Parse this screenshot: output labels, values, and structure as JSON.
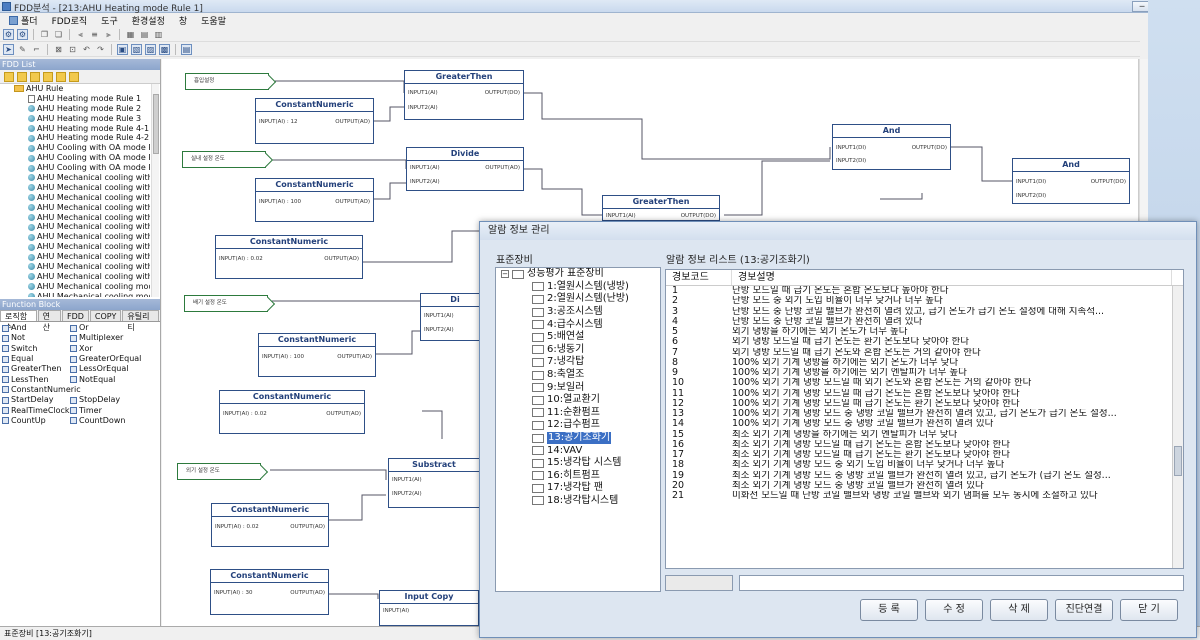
{
  "window": {
    "title": "FDD분석 - [213:AHU Heating mode Rule 1]",
    "controls": [
      "─",
      "□",
      "✕"
    ]
  },
  "menu": [
    "폴더",
    "FDD로직",
    "도구",
    "환경설정",
    "창",
    "도움말"
  ],
  "left_panel": {
    "fdd_list_title": "FDD List",
    "tree": [
      {
        "label": "AHU Rule",
        "level": 0,
        "type": "folder"
      },
      {
        "label": "AHU Heating mode Rule 1",
        "level": 1,
        "type": "doc"
      },
      {
        "label": "AHU Heating mode Rule 2",
        "level": 1,
        "type": "gear"
      },
      {
        "label": "AHU Heating mode Rule 3",
        "level": 1,
        "type": "gear"
      },
      {
        "label": "AHU Heating mode Rule 4-1",
        "level": 1,
        "type": "gear"
      },
      {
        "label": "AHU Heating mode Rule 4-2",
        "level": 1,
        "type": "gear"
      },
      {
        "label": "AHU Cooling with OA mode Rule",
        "level": 1,
        "type": "gear"
      },
      {
        "label": "AHU Cooling with OA mode Rule",
        "level": 1,
        "type": "gear"
      },
      {
        "label": "AHU Cooling with OA mode Rule",
        "level": 1,
        "type": "gear"
      },
      {
        "label": "AHU Mechanical cooling with",
        "level": 1,
        "type": "gear"
      },
      {
        "label": "AHU Mechanical cooling with",
        "level": 1,
        "type": "gear"
      },
      {
        "label": "AHU Mechanical cooling with",
        "level": 1,
        "type": "gear"
      },
      {
        "label": "AHU Mechanical cooling with",
        "level": 1,
        "type": "gear"
      },
      {
        "label": "AHU Mechanical cooling with",
        "level": 1,
        "type": "gear"
      },
      {
        "label": "AHU Mechanical cooling with",
        "level": 1,
        "type": "gear"
      },
      {
        "label": "AHU Mechanical cooling with",
        "level": 1,
        "type": "gear"
      },
      {
        "label": "AHU Mechanical cooling with",
        "level": 1,
        "type": "gear"
      },
      {
        "label": "AHU Mechanical cooling with",
        "level": 1,
        "type": "gear"
      },
      {
        "label": "AHU Mechanical cooling with",
        "level": 1,
        "type": "gear"
      },
      {
        "label": "AHU Mechanical cooling with",
        "level": 1,
        "type": "gear"
      },
      {
        "label": "AHU Mechanical cooling mod",
        "level": 1,
        "type": "gear"
      },
      {
        "label": "AHU Mechanical cooling mod",
        "level": 1,
        "type": "gear"
      }
    ],
    "function_block_title": "Function Block",
    "tabs": [
      "로직함수",
      "연산",
      "FDD",
      "COPY",
      "유틸리티"
    ],
    "functions": [
      [
        "And",
        "Or"
      ],
      [
        "Not",
        "Multiplexer"
      ],
      [
        "Switch",
        "Xor"
      ],
      [
        "Equal",
        "GreaterOrEqual"
      ],
      [
        "GreaterThen",
        "LessOrEqual"
      ],
      [
        "LessThen",
        "NotEqual"
      ],
      [
        "ConstantNumeric",
        ""
      ],
      [
        "StartDelay",
        "StopDelay"
      ],
      [
        "RealTimeClock",
        "Timer"
      ],
      [
        "CountUp",
        "CountDown"
      ]
    ]
  },
  "canvas": {
    "labels": [
      "흡입설정",
      "실내 설정 온도",
      "배기 설정 온도",
      "외기 설정 온도"
    ],
    "blocks": {
      "greater1": {
        "title": "GreaterThen",
        "in1": "INPUT1(AI)",
        "in2": "INPUT2(AI)",
        "out": "OUTPUT(DO)"
      },
      "const1": {
        "title": "ConstantNumeric",
        "in": "INPUT(AI) : 12",
        "out": "OUTPUT(AO)"
      },
      "divide": {
        "title": "Divide",
        "in1": "INPUT1(AI)",
        "in2": "INPUT2(AI)",
        "out": "OUTPUT(AO)"
      },
      "const2": {
        "title": "ConstantNumeric",
        "in": "INPUT(AI) : 100",
        "out": "OUTPUT(AO)"
      },
      "greater2": {
        "title": "GreaterThen",
        "in1": "INPUT1(AI)",
        "out": "OUTPUT(DO)"
      },
      "and1": {
        "title": "And",
        "in1": "INPUT1(DI)",
        "in2": "INPUT2(DI)",
        "out": "OUTPUT(DO)"
      },
      "and2": {
        "title": "And",
        "in1": "INPUT1(DI)",
        "in2": "INPUT2(DI)",
        "out": "OUTPUT(DO)"
      },
      "const3": {
        "title": "ConstantNumeric",
        "in": "INPUT(AI) : 0.02",
        "out": "OUTPUT(AO)"
      },
      "divide2": {
        "title": "Di",
        "in1": "INPUT1(AI)",
        "in2": "INPUT2(AI)"
      },
      "const4": {
        "title": "ConstantNumeric",
        "in": "INPUT(AI) : 100",
        "out": "OUTPUT(AO)"
      },
      "const5": {
        "title": "ConstantNumeric",
        "in": "INPUT(AI) : 0.02",
        "out": "OUTPUT(AO)"
      },
      "subtract": {
        "title": "Substract",
        "in1": "INPUT1(AI)",
        "in2": "INPUT2(AI)"
      },
      "const6": {
        "title": "ConstantNumeric",
        "in": "INPUT(AI) : 0.02",
        "out": "OUTPUT(AO)"
      },
      "const7": {
        "title": "ConstantNumeric",
        "in": "INPUT(AI) : 30",
        "out": "OUTPUT(AO)"
      },
      "inputcopy": {
        "title": "Input Copy",
        "in": "INPUT(AI)"
      }
    }
  },
  "dialog": {
    "title": "알람 정보 관리",
    "equipment_label": "표준장비",
    "list_label": "알람 정보 리스트 (13:공기조화기)",
    "tree_root": "성능평가 표준장비",
    "tree_items": [
      "1:열원시스템(냉방)",
      "2:열원시스템(난방)",
      "3:공조시스템",
      "4:급수시스템",
      "5:배연설",
      "6:냉동기",
      "7:냉각탑",
      "8:축열조",
      "9:보일러",
      "10:열교환기",
      "11:순환펌프",
      "12:급수펌프",
      "13:공기조화기",
      "14:VAV",
      "15:냉각탑 시스템",
      "16:히트펌프",
      "17:냉각탑 팬",
      "18:냉각탑시스템"
    ],
    "selected_item": "13:공기조화기",
    "columns": [
      "경보코드",
      "경보설명"
    ],
    "rows": [
      [
        "1",
        "난방 모드일 때 급기 온도는 혼합 온도보다 높아야 한다"
      ],
      [
        "2",
        "난방 모드 중 외기 도입 비율이 너무 낮거나 너무 높다"
      ],
      [
        "3",
        "난방 모드 중 난방 코일 밸브가 완전히 열려 있고, 급기 온도가 급기 온도 설정에 대해 지속적..."
      ],
      [
        "4",
        "난방 모드 중 난방 코일 밸브가 완전히 열려 있다"
      ],
      [
        "5",
        "외기 냉방을 하기에는 외기 온도가 너무 높다"
      ],
      [
        "6",
        "외기 냉방 모드일 때 급기 온도는 환기 온도보다 낮아야 한다"
      ],
      [
        "7",
        "외기 냉방 모드일 때 급기 온도와 혼합 온도는 거의 같아야 한다"
      ],
      [
        "8",
        "100% 외기 기계 냉방을 하기에는 외기 온도가 너무 낮다"
      ],
      [
        "9",
        "100% 외기 기계 냉방을 하기에는 외기 엔탈피가 너무 높다"
      ],
      [
        "10",
        "100% 외기 기계 냉방 모드일 때 외기 온도와 혼합 온도는 거의 같아야 한다"
      ],
      [
        "11",
        "100% 외기 기계 냉방 모드일 때 급기 온도는 혼합 온도보다 낮아야 한다"
      ],
      [
        "12",
        "100% 외기 기계 냉방 모드일 때 급기 온도는 환기 온도보다 낮아야 한다"
      ],
      [
        "13",
        "100% 외기 기계 냉방 모드 중 냉방 코일 밸브가 완전히 열려 있고, 급기 온도가 급기 온도 설정..."
      ],
      [
        "14",
        "100% 외기 기계 냉방 모드 중 냉방 코일 밸브가 완전히 열려 있다"
      ],
      [
        "15",
        "최소 외기 기계 냉방을 하기에는 외기 엔탈피가 너무 낮다"
      ],
      [
        "16",
        "최소 외기 기계 냉방 모드일 때 급기 온도는 혼합 온도보다 낮아야 한다"
      ],
      [
        "17",
        "최소 외기 기계 냉방 모드일 때 급기 온도는 환기 온도보다 낮아야 한다"
      ],
      [
        "18",
        "최소 외기 기계 냉방 모드 중 외기 도입 비율이 너무 낮거나 너무 높다"
      ],
      [
        "19",
        "최소 외기 기계 냉방 모드 중 냉방 코일 밸브가 완전히 열려 있고, 급기 온도가 (급기 온도 설정..."
      ],
      [
        "20",
        "최소 외기 기계 냉방 모드 중 냉방 코일 밸브가 완전히 열려 있다"
      ],
      [
        "21",
        "미화전 모드일 때 난방 코일 밸브와 냉방 코일 밸브와 외기 댐퍼를 모두 동시에 조절하고 있다"
      ]
    ],
    "buttons": [
      "등 록",
      "수 정",
      "삭 제",
      "진단연결",
      "닫 기"
    ]
  },
  "status": "표준장비 [13:공기조화기]"
}
